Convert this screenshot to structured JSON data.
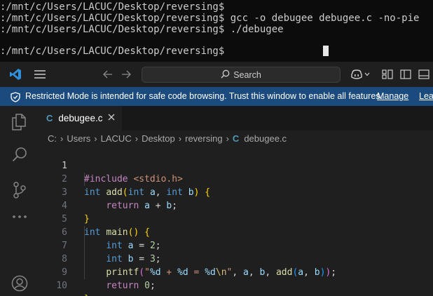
{
  "terminal": {
    "lines": [
      ":/mnt/c/Users/LACUC/Desktop/reversing$ ",
      ":/mnt/c/Users/LACUC/Desktop/reversing$ gcc -o debugee debugee.c -no-pie",
      ":/mnt/c/Users/LACUC/Desktop/reversing$ ./debugee",
      "",
      ":/mnt/c/Users/LACUC/Desktop/reversing$ "
    ]
  },
  "titlebar": {
    "search_label": "Search",
    "icons": [
      "vscode-logo-icon",
      "hamburger-menu-icon",
      "back-arrow-icon",
      "forward-arrow-icon",
      "search-icon",
      "copilot-icon",
      "chevron-down-icon",
      "customize-layout-icon",
      "toggle-sidebar-icon",
      "toggle-panel-icon"
    ]
  },
  "banner": {
    "message": "Restricted Mode is intended for safe code browsing. Trust this window to enable all features.",
    "manage_label": "Manage",
    "learn_label": "Lea"
  },
  "activity_bar": {
    "items": [
      "explorer-icon",
      "search-icon",
      "source-control-icon",
      "more-icon",
      "accounts-icon"
    ]
  },
  "tab": {
    "icon_letter": "C",
    "filename": "debugee.c",
    "close_glyph": "✕"
  },
  "breadcrumb": {
    "items": [
      "C:",
      "Users",
      "LACUC",
      "Desktop",
      "reversing"
    ],
    "file_icon_letter": "C",
    "file": "debugee.c"
  },
  "editor": {
    "active_line": 1,
    "line_numbers": [
      "1",
      "2",
      "3",
      "4",
      "5",
      "6",
      "7",
      "8",
      "9",
      "10"
    ],
    "lines": [
      "#include <stdio.h>",
      "int add(int a, int b) {",
      "    return a + b;",
      "}",
      "int main() {",
      "    int a = 2;",
      "    int b = 3;",
      "    printf(\"%d + %d = %d\\n\", a, b, add(a, b));",
      "    return 0;",
      "}"
    ]
  },
  "colors": {
    "banner_bg": "#1b4a7e",
    "editor_bg": "#1f1f1f",
    "terminal_bg": "#0c0c0c",
    "keyword": "#569cd6",
    "function": "#dcdcaa",
    "string": "#ce9178",
    "number": "#b5cea8",
    "control": "#c586c0"
  }
}
